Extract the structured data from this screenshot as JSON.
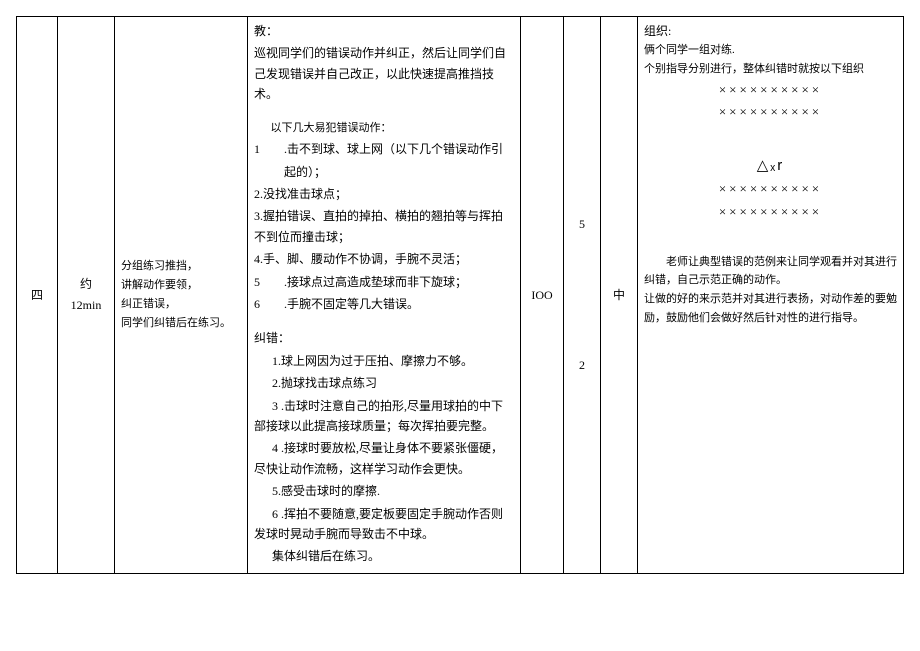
{
  "row": {
    "index": "四",
    "time_label_pre": "约",
    "time": "12min",
    "left_block": {
      "l1": "分组练习推挡，",
      "l2": "讲解动作要领，",
      "l3": "纠正错误，",
      "l4": "同学们纠错后在练习。"
    },
    "main_block": {
      "teach_head": "教：",
      "teach_para": "巡视同学们的错误动作并纠正，然后让同学们自己发现错误并自己改正，以此快速提高推挡技术。",
      "mistake_head": "以下几大易犯错误动作：",
      "m1a": "1　　.击不到球、球上网（以下几个错误动作引",
      "m1b": "起的）；",
      "m2": "2.没找准击球点；",
      "m3": "3.握拍错误、直拍的掉拍、横拍的翘拍等与挥拍不到位而撞击球；",
      "m4": "4.手、脚、腰动作不协调，手腕不灵活；",
      "m5": "5　　.接球点过高造成垫球而非下旋球；",
      "m6": "6　　.手腕不固定等几大错误。",
      "fix_head": "纠错：",
      "f1": "1.球上网因为过于压拍、摩擦力不够。",
      "f2": "2.抛球找击球点练习",
      "f3": "3 .击球时注意自己的拍形,尽量用球拍的中下部接球以此提高接球质量；每次挥拍要完整。",
      "f4": "4 .接球时要放松,尽量让身体不要紧张僵硬，尽快让动作流畅，这样学习动作会更快。",
      "f5": "5.感受击球时的摩擦.",
      "f6": "6 .挥拍不要随意,要定板要固定手腕动作否则发球时晃动手腕而导致击不中球。",
      "end": "集体纠错后在练习。"
    },
    "n1_top": "IOO",
    "n2_top": "5",
    "n2_bot": "2",
    "n3": "中",
    "org": {
      "head": "组织:",
      "g1": "俩个同学一组对练.",
      "g2": "个别指导分别进行，整体纠错时就按以下组织",
      "xrow1": "××××××××××",
      "xrow2": "××××××××××",
      "tri": "△ₓr",
      "xrow3": "××××××××××",
      "xrow4": "××××××××××",
      "note1": "　　老师让典型错误的范例来让同学观看并对其进行纠错，自己示范正确的动作。",
      "note2": "让做的好的来示范并对其进行表扬，对动作差的要勉励，鼓励他们会做好然后针对性的进行指导。"
    }
  }
}
